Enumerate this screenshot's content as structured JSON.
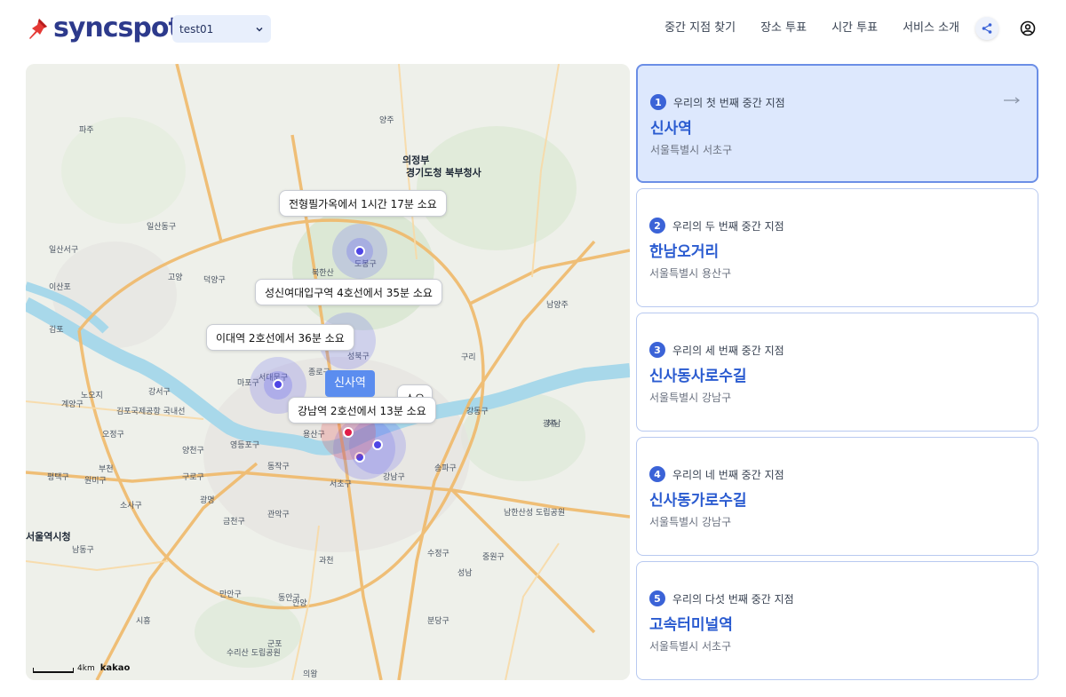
{
  "header": {
    "logo_text": "syncspot",
    "group_select": "test01",
    "nav": [
      "중간 지점 찾기",
      "장소 투표",
      "시간 투표",
      "서비스 소개"
    ]
  },
  "map": {
    "labels": [
      "의정부",
      "경기도청 북부청사",
      "양주",
      "파주",
      "고양",
      "김포",
      "구리",
      "남양주",
      "하남",
      "성남",
      "과천",
      "광명",
      "부천",
      "안양",
      "군포",
      "의왕",
      "광주",
      "서울역시청",
      "서초구",
      "강남구",
      "동작구",
      "용산구",
      "종로구",
      "성북구",
      "도봉구",
      "북한산",
      "서대문구",
      "일산동구",
      "일산서구",
      "이산포",
      "덕양구",
      "마포구",
      "강서구",
      "김포국제공항 국내선",
      "양천구",
      "구로구",
      "영등포구",
      "관악구",
      "금천구",
      "송파구",
      "강동구",
      "수정구",
      "중원구",
      "분당구",
      "남한산성 도립공원",
      "수리산 도립공원",
      "시흥",
      "동안구",
      "만안구",
      "소사구",
      "남동구",
      "계양구",
      "노오지",
      "오정구",
      "원미구",
      "평택구"
    ],
    "callouts": [
      "전형필가옥에서 1시간 17분 소요",
      "성신여대입구역 4호선에서 35분 소요",
      "이대역 2호선에서 36분 소요",
      "강남역 2호선에서 13분 소요",
      "소요"
    ],
    "center_tag": "신사역",
    "scale_text": "4km",
    "attribution": "kakao"
  },
  "cards": [
    {
      "num": "1",
      "subtitle": "우리의 첫 번째 중간 지점",
      "title": "신사역",
      "address": "서울특별시 서초구"
    },
    {
      "num": "2",
      "subtitle": "우리의 두 번째 중간 지점",
      "title": "한남오거리",
      "address": "서울특별시 용산구"
    },
    {
      "num": "3",
      "subtitle": "우리의 세 번째 중간 지점",
      "title": "신사동사로수길",
      "address": "서울특별시 강남구"
    },
    {
      "num": "4",
      "subtitle": "우리의 네 번째 중간 지점",
      "title": "신사동가로수길",
      "address": "서울특별시 강남구"
    },
    {
      "num": "5",
      "subtitle": "우리의 다섯 번째 중간 지점",
      "title": "고속터미널역",
      "address": "서울특별시 서초구"
    }
  ],
  "colors": {
    "brand": "#2d3a8c",
    "accent": "#3b63d7",
    "active_card": "#dde8fd",
    "river": "#9fd3e6"
  }
}
